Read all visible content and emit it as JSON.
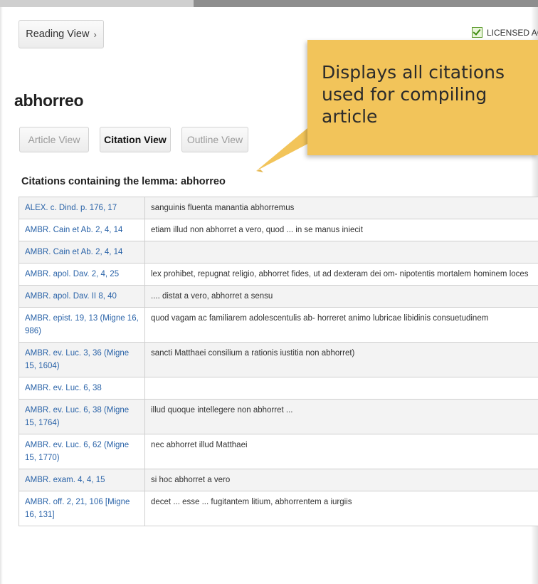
{
  "header": {
    "reading_view_label": "Reading View",
    "licensed_label": "LICENSED AC"
  },
  "lemma": "abhorreo",
  "tabs": {
    "article": "Article View",
    "citation": "Citation View",
    "outline": "Outline View"
  },
  "callout": {
    "text": "Displays all citations used for compiling article"
  },
  "section_title": "Citations containing the lemma: abhorreo",
  "citations": [
    {
      "source": "ALEX. c. Dind. p. 176, 17",
      "text": "sanguinis fluenta manantia abhorremus"
    },
    {
      "source": "AMBR. Cain et Ab. 2, 4, 14",
      "text": "etiam illud non abhorret a vero, quod ... in se manus iniecit"
    },
    {
      "source": "AMBR. Cain et Ab. 2, 4, 14",
      "text": ""
    },
    {
      "source": "AMBR. apol. Dav. 2, 4, 25",
      "text": "lex prohibet, repugnat religio, abhorret fides, ut ad dexteram dei om- nipotentis mortalem hominem loces"
    },
    {
      "source": "AMBR. apol. Dav. II 8, 40",
      "text": ".... distat a vero, abhorret a sensu"
    },
    {
      "source": "AMBR. epist. 19, 13 (Migne 16, 986)",
      "text": "quod vagam ac familiarem adolescentulis ab- horreret animo lubricae libidinis consuetudinem"
    },
    {
      "source": "AMBR. ev. Luc. 3, 36 (Migne 15, 1604)",
      "text": "sancti Matthaei consilium a rationis iustitia non abhorret)"
    },
    {
      "source": "AMBR. ev. Luc. 6, 38",
      "text": ""
    },
    {
      "source": "AMBR. ev. Luc. 6, 38 (Migne 15, 1764)",
      "text": "illud quoque intellegere non abhorret ..."
    },
    {
      "source": "AMBR. ev. Luc. 6, 62 (Migne 15, 1770)",
      "text": "nec abhorret illud Matthaei"
    },
    {
      "source": "AMBR. exam. 4, 4, 15",
      "text": "si hoc abhorret a vero"
    },
    {
      "source": "AMBR. off. 2, 21, 106 [Migne 16, 131]",
      "text": "decet ... esse ... fugitantem litium, abhorrentem a iurgiis"
    }
  ]
}
